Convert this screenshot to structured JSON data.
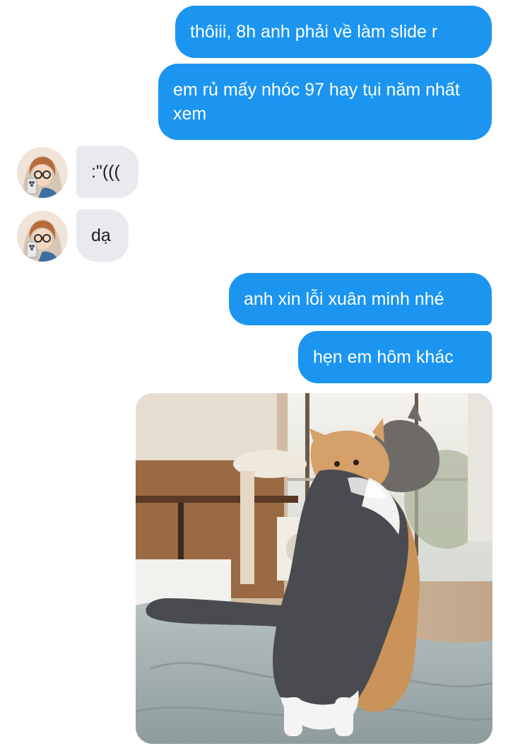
{
  "thread": {
    "messages": [
      {
        "direction": "outgoing",
        "text": "thôiii, 8h anh phải về làm slide r"
      },
      {
        "direction": "outgoing",
        "text": "em rủ mấy nhóc 97 hay tụi năm nhất xem"
      },
      {
        "direction": "incoming",
        "text": ":\"((("
      },
      {
        "direction": "incoming",
        "text": "dạ"
      },
      {
        "direction": "outgoing",
        "text": "anh xin lỗi xuân minh nhé"
      },
      {
        "direction": "outgoing",
        "text": "hẹn em hôm khác"
      },
      {
        "direction": "outgoing",
        "type": "image",
        "image_icon": "photo-of-two-cats-hugging-on-bed"
      }
    ]
  },
  "colors": {
    "outgoing_bubble": "#1b95f0",
    "incoming_bubble": "#e8eaee",
    "outgoing_text": "#ffffff",
    "incoming_text": "#1c1e21"
  },
  "contact": {
    "avatar_icon": "girl-with-glasses-and-phone-avatar"
  }
}
